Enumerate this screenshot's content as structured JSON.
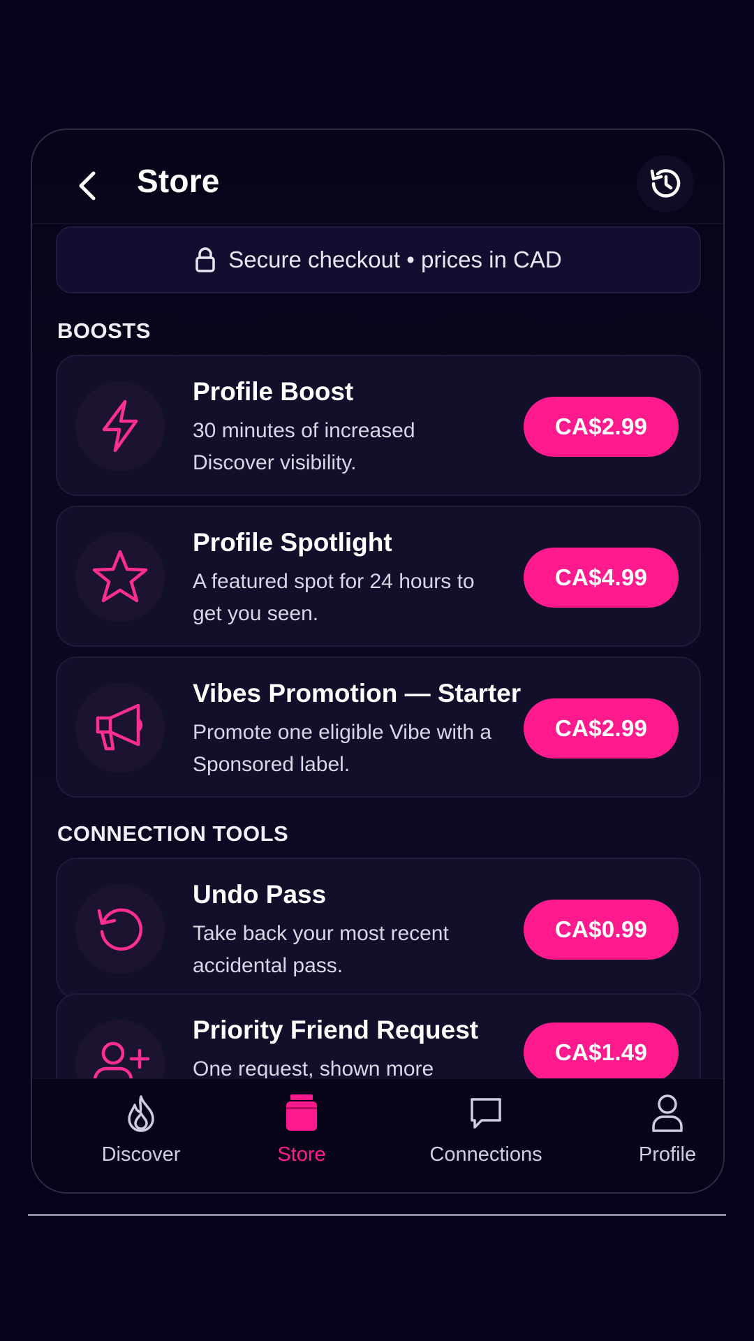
{
  "header": {
    "title": "Store"
  },
  "banner": {
    "text": "Secure checkout • prices in CAD"
  },
  "sections": {
    "boosts": "BOOSTS",
    "connection_tools": "CONNECTION TOOLS"
  },
  "items": [
    {
      "title": "Profile Boost",
      "description": "30 minutes of increased Discover visibility.",
      "price": "CA$2.99",
      "icon": "lightning-icon"
    },
    {
      "title": "Profile Spotlight",
      "description": "A featured spot for 24 hours to get you seen.",
      "price": "CA$4.99",
      "icon": "star-icon"
    },
    {
      "title": "Vibes Promotion — Starter",
      "description": "Promote one eligible Vibe with a Sponsored label.",
      "price": "CA$2.99",
      "icon": "megaphone-icon"
    },
    {
      "title": "Undo Pass",
      "description": "Take back your most recent accidental pass.",
      "price": "CA$0.99",
      "icon": "undo-icon"
    },
    {
      "title": "Priority Friend Request",
      "description": "One request, shown more prominently.",
      "price": "CA$1.49",
      "icon": "add-friend-icon"
    }
  ],
  "tabs": [
    {
      "label": "Discover",
      "icon": "flame-icon",
      "active": false
    },
    {
      "label": "Store",
      "icon": "store-icon",
      "active": true
    },
    {
      "label": "Connections",
      "icon": "chat-icon",
      "active": false
    },
    {
      "label": "Profile",
      "icon": "person-icon",
      "active": false
    }
  ],
  "colors": {
    "accent": "#ff1b8d",
    "background": "#05031a",
    "card": "#120f2a"
  }
}
